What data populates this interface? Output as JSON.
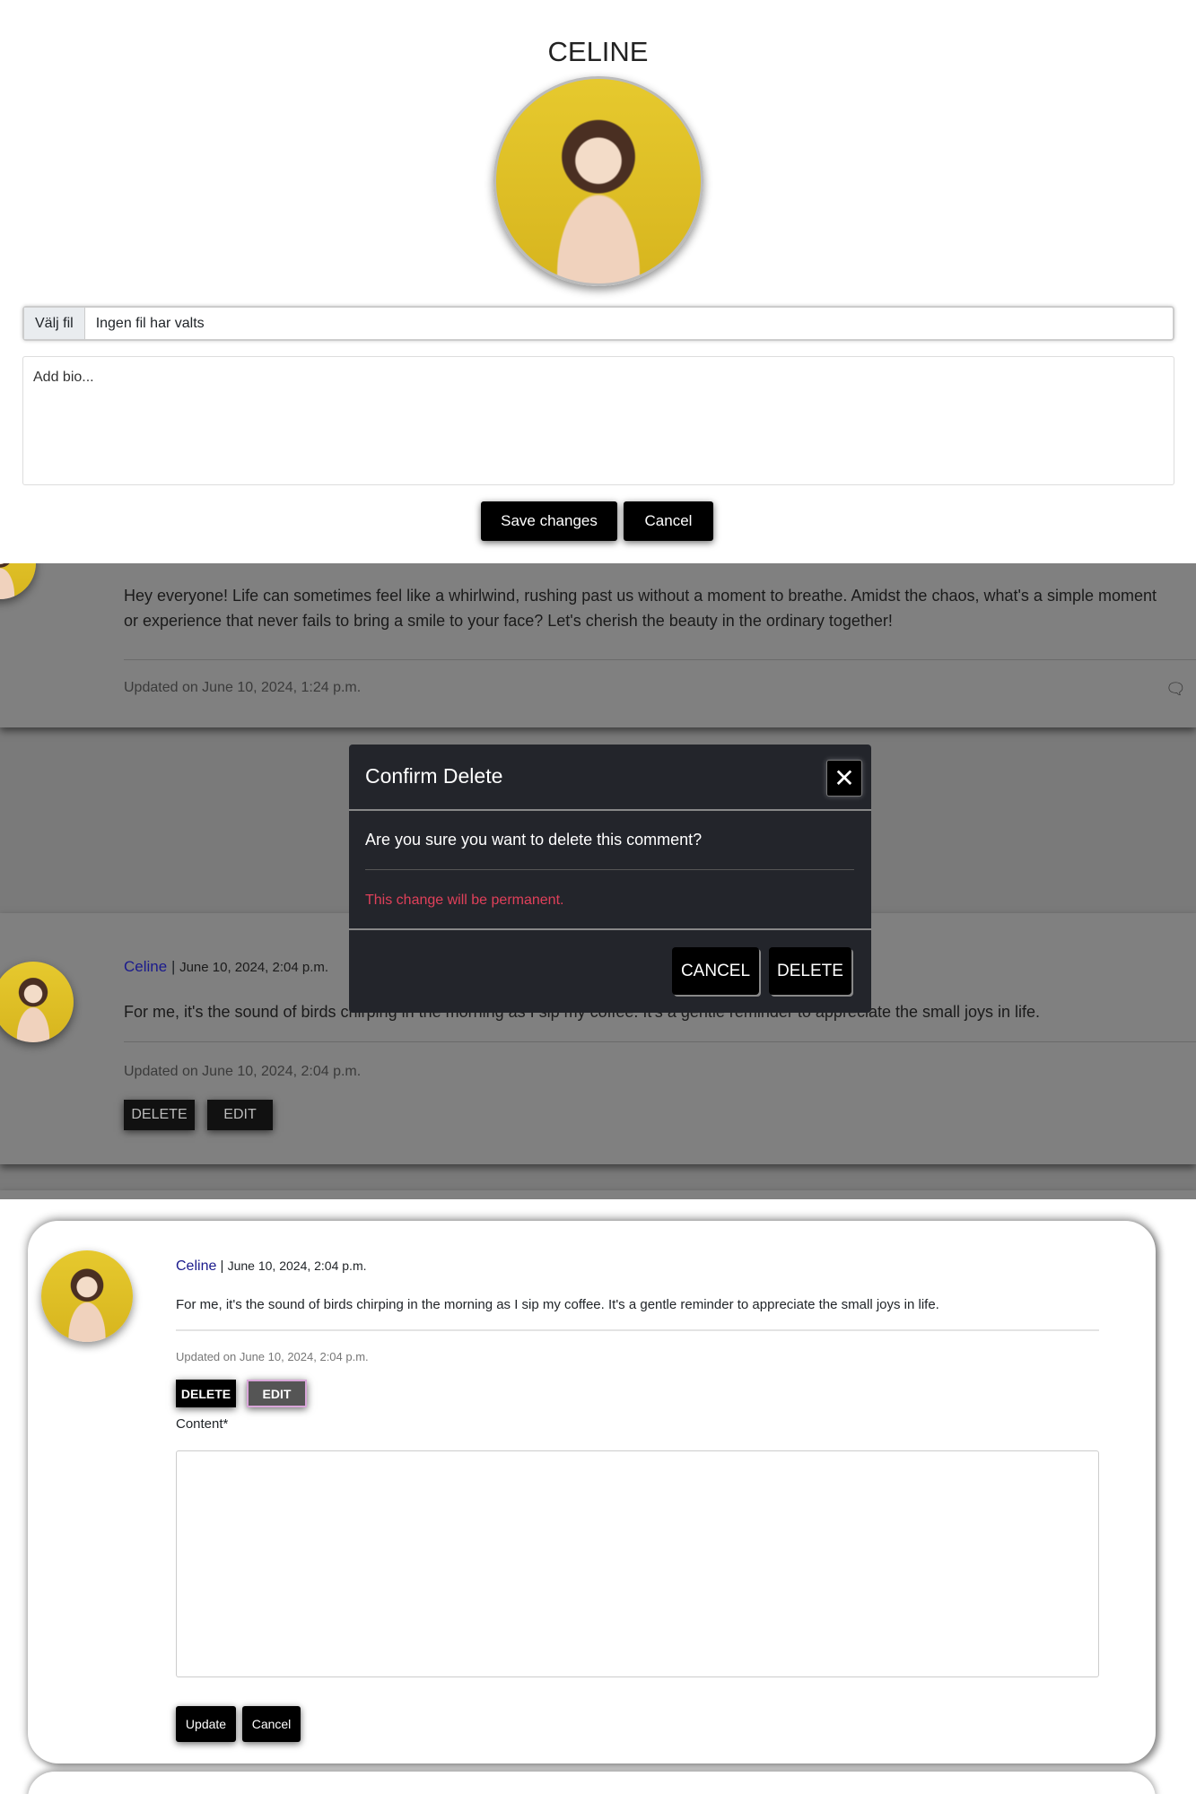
{
  "profile": {
    "name": "CELINE",
    "file_button": "Välj fil",
    "file_status": "Ingen fil har valts",
    "bio_placeholder": "Add bio...",
    "save_label": "Save changes",
    "cancel_label": "Cancel"
  },
  "post": {
    "content": "Hey everyone! Life can sometimes feel like a whirlwind, rushing past us without a moment to breathe. Amidst the chaos, what's a simple moment or experience that never fails to bring a smile to your face? Let's cherish the beauty in the ordinary together!",
    "updated": "Updated on June 10, 2024, 1:24 p.m."
  },
  "comment": {
    "author": "Celine",
    "separator": "|",
    "date": "June 10, 2024, 2:04 p.m.",
    "content": "For me, it's the sound of birds chirping in the morning as I sip my coffee. It's a gentle reminder to appreciate the small joys in life.",
    "updated": "Updated on June 10, 2024, 2:04 p.m.",
    "delete_label": "DELETE",
    "edit_label": "EDIT"
  },
  "modal": {
    "title": "Confirm Delete",
    "question": "Are you sure you want to delete this comment?",
    "warning": "This change will be permanent.",
    "cancel_label": "CANCEL",
    "delete_label": "DELETE"
  },
  "edit_form": {
    "content_label": "Content*",
    "update_label": "Update",
    "cancel_label": "Cancel"
  },
  "colors": {
    "author_link": "#1a1a8c",
    "warning": "#e0405a",
    "modal_bg": "#23252b"
  }
}
